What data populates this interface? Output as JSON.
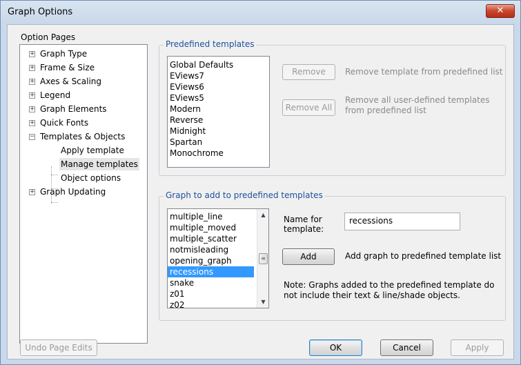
{
  "window": {
    "title": "Graph Options",
    "close_glyph": "✕"
  },
  "option_pages": {
    "label": "Option Pages",
    "tree": [
      {
        "label": "Graph Type",
        "expander": "+"
      },
      {
        "label": "Frame & Size",
        "expander": "+"
      },
      {
        "label": "Axes & Scaling",
        "expander": "+"
      },
      {
        "label": "Legend",
        "expander": "+"
      },
      {
        "label": "Graph Elements",
        "expander": "+"
      },
      {
        "label": "Quick Fonts",
        "expander": "+"
      },
      {
        "label": "Templates & Objects",
        "expander": "−"
      },
      {
        "label": "Apply template"
      },
      {
        "label": "Manage templates"
      },
      {
        "label": "Object options"
      },
      {
        "label": "Graph Updating",
        "expander": "+"
      }
    ]
  },
  "predefined": {
    "legend": "Predefined templates",
    "items": [
      "Global Defaults",
      "EViews7",
      "EViews6",
      "EViews5",
      "Modern",
      "Reverse",
      "Midnight",
      "Spartan",
      "Monochrome"
    ],
    "remove_label": "Remove",
    "remove_desc": "Remove template from predefined list",
    "remove_all_label": "Remove All",
    "remove_all_desc_1": "Remove all user-defined templates",
    "remove_all_desc_2": "from predefined list"
  },
  "add_graph": {
    "legend": "Graph to add to predefined templates",
    "items": [
      "multiple_line",
      "multiple_moved",
      "multiple_scatter",
      "notmisleading",
      "opening_graph",
      "recessions",
      "snake",
      "z01",
      "z02"
    ],
    "selected_item": "recessions",
    "name_label_1": "Name for",
    "name_label_2": "template:",
    "name_value": "recessions",
    "add_label": "Add",
    "add_desc": "Add graph to predefined template list",
    "note_1": "Note: Graphs added to the predefined template do",
    "note_2": "not include their text & line/shade objects."
  },
  "footer": {
    "undo_label": "Undo Page Edits",
    "ok_label": "OK",
    "cancel_label": "Cancel",
    "apply_label": "Apply"
  }
}
